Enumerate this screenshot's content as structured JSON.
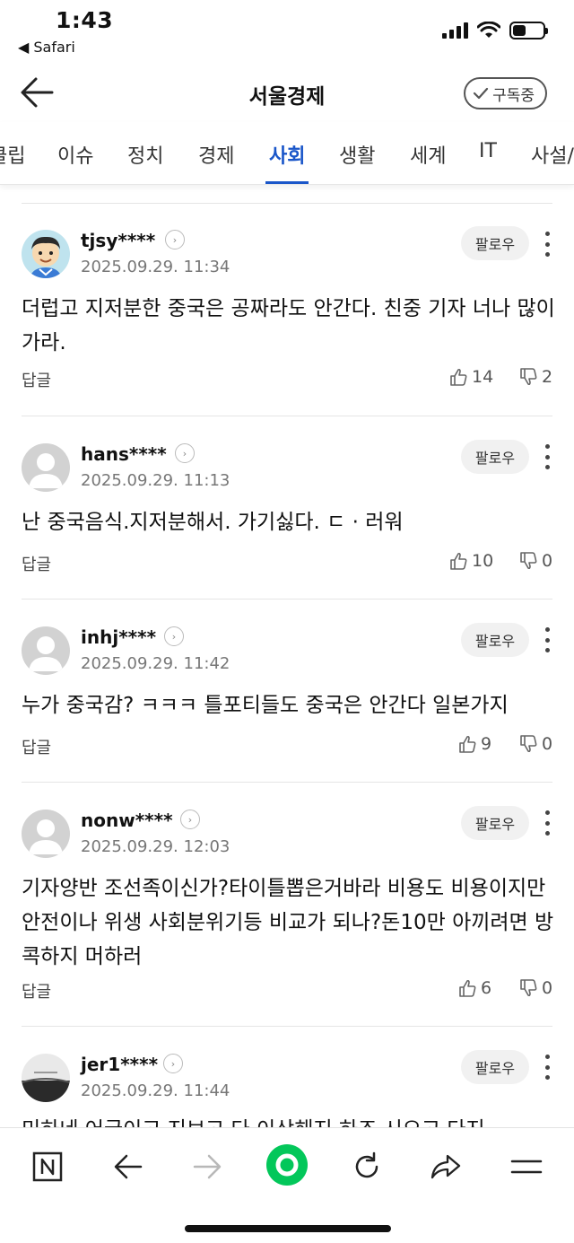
{
  "status_bar": {
    "time": "1:43",
    "back_app": "◀ Safari",
    "battery_level": 0.45
  },
  "header": {
    "title": "서울경제",
    "subscribe_label": "구독중"
  },
  "tabs": {
    "items": [
      "클립",
      "이슈",
      "정치",
      "경제",
      "사회",
      "생활",
      "세계",
      "IT",
      "사설/"
    ],
    "active": "사회",
    "active_color": "#1a56c9"
  },
  "comments": [
    {
      "username": "tjsy****",
      "timestamp": "2025.09.29. 11:34",
      "text": "더럽고 지저분한 중국은 공짜라도 안간다. 친중 기자 너나 많이 가라.",
      "likes": "14",
      "dislikes": "2",
      "avatar": "cartoon-avatar"
    },
    {
      "username": "hans****",
      "timestamp": "2025.09.29. 11:13",
      "text": "난 중국음식.지저분해서. 가기싫다. ㄷ · 러워",
      "likes": "10",
      "dislikes": "0",
      "avatar": "default-avatar"
    },
    {
      "username": "inhj****",
      "timestamp": "2025.09.29. 11:42",
      "text": "누가 중국감? ㅋㅋㅋ 틀포티들도 중국은 안간다 일본가지",
      "likes": "9",
      "dislikes": "0",
      "avatar": "default-avatar"
    },
    {
      "username": "nonw****",
      "timestamp": "2025.09.29. 12:03",
      "text": "기자양반 조선족이신가?타이틀뽑은거바라 비용도 비용이지만 안전이나 위생 사회분위기등 비교가 되나?돈10만 아끼려면 방콕하지 머하러",
      "likes": "6",
      "dislikes": "0",
      "avatar": "default-avatar"
    },
    {
      "username": "jer1****",
      "timestamp": "2025.09.29. 11:44",
      "text": "미하네 어글이고 지보고 다 이상해지 하죠 시으고 다지",
      "likes": "",
      "dislikes": "",
      "avatar": "photo-avatar"
    }
  ],
  "labels": {
    "follow": "팔로우",
    "reply": "답글"
  },
  "toolbar": {
    "items": [
      "naver-home-icon",
      "back-icon",
      "forward-icon",
      "green-dot-icon",
      "reload-icon",
      "share-icon",
      "menu-icon"
    ],
    "brand_color": "#03c75a"
  }
}
